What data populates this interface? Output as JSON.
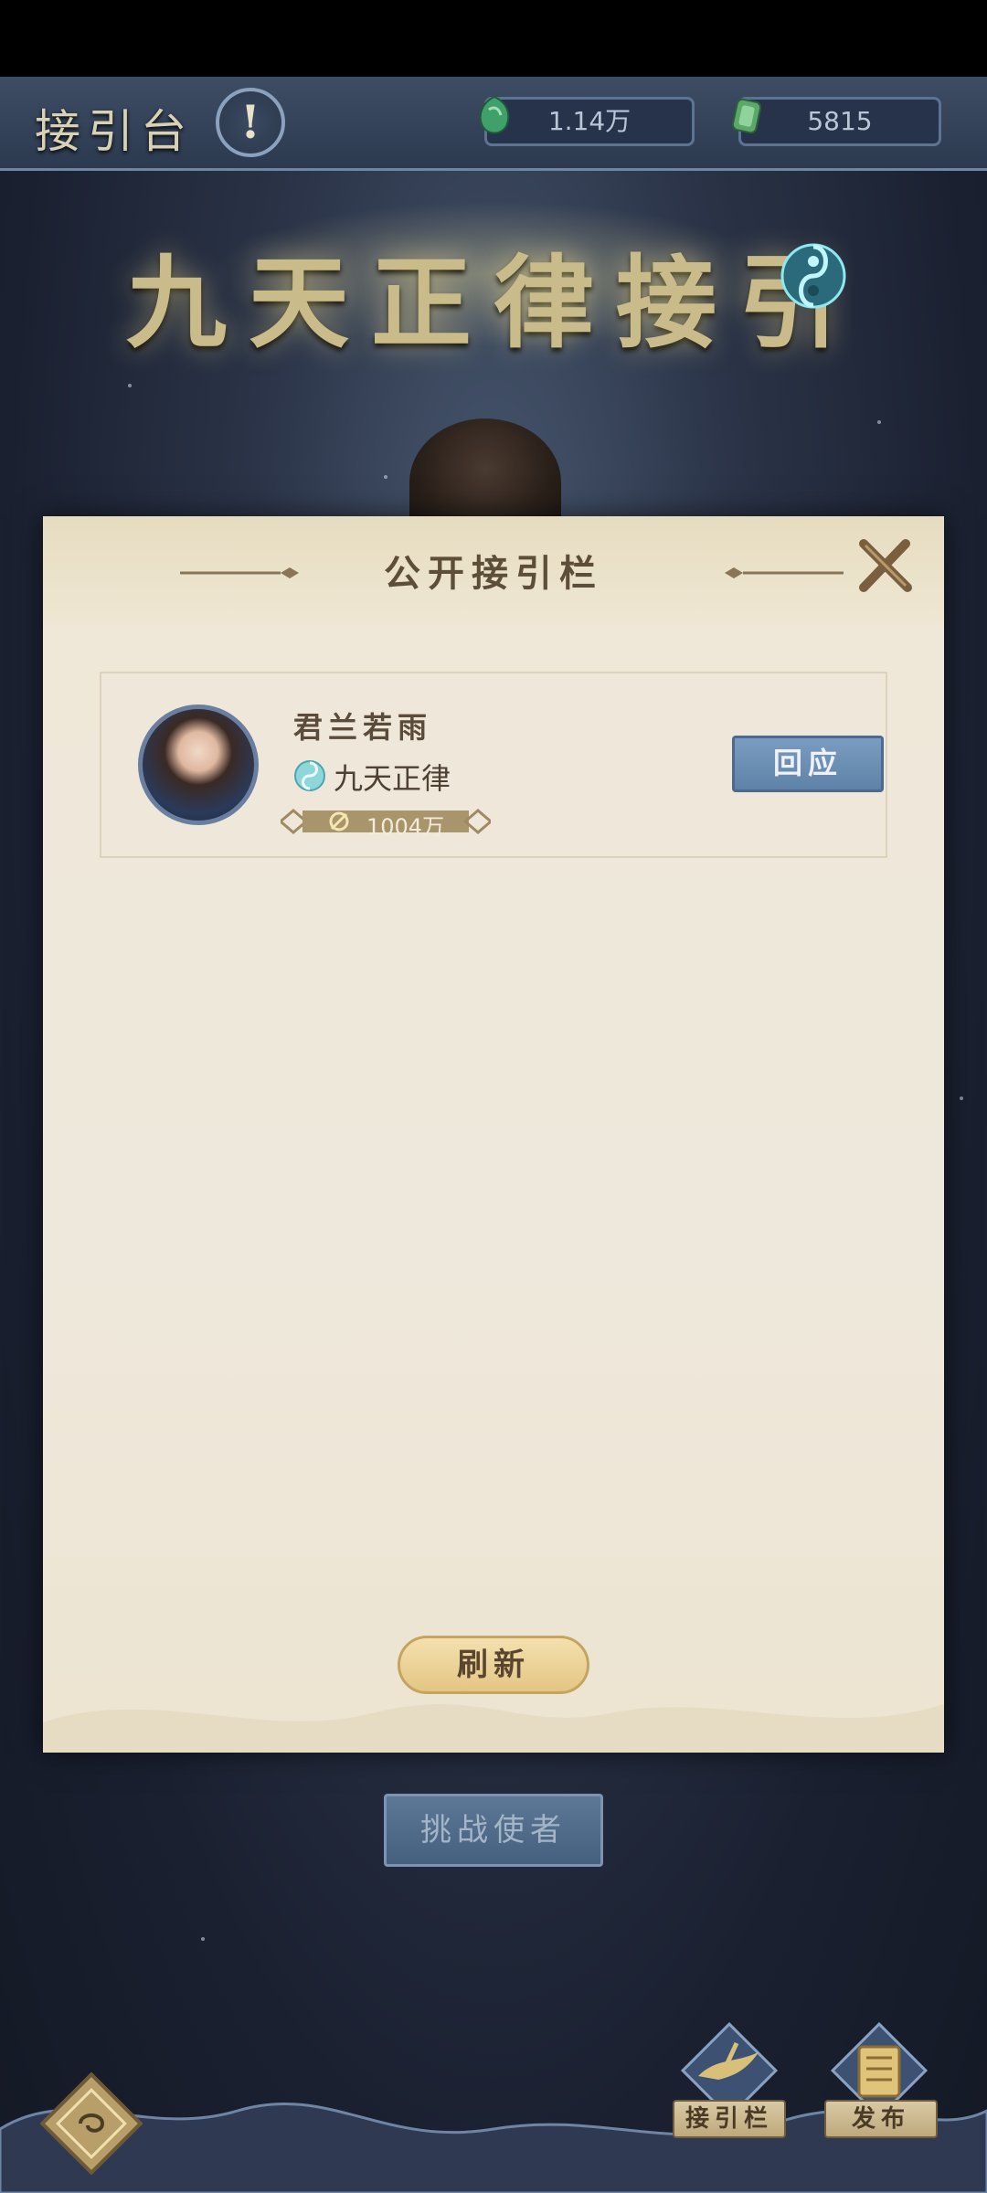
{
  "topbar": {
    "title": "接引台",
    "info_symbol": "!",
    "currency_1": "1.14万",
    "currency_2": "5815"
  },
  "hero": {
    "title": "九天正律接引"
  },
  "panel": {
    "title": "公开接引栏",
    "entries": [
      {
        "name": "君兰若雨",
        "faction": "九天正律",
        "power": "1004万",
        "action_label": "回应"
      }
    ],
    "refresh_label": "刷新"
  },
  "challenge_label": "挑战使者",
  "bottom_nav": {
    "tab_1": "接引栏",
    "tab_2": "发布"
  },
  "colors": {
    "panel_bg": "#eee8dc",
    "respond_button": "#6a8cb2",
    "refresh_button": "#ebd196",
    "hero_title": "#c9bc8a"
  }
}
